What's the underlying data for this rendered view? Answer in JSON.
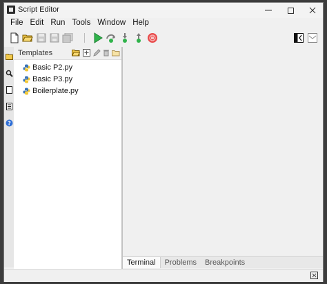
{
  "window": {
    "title": "Script Editor"
  },
  "menubar": [
    "File",
    "Edit",
    "Run",
    "Tools",
    "Window",
    "Help"
  ],
  "toolbar": {
    "buttons": [
      "new-file-icon",
      "open-folder-icon",
      "save-icon",
      "save-as-icon",
      "save-all-icon",
      "run-icon",
      "step-over-icon",
      "step-into-icon",
      "step-out-icon",
      "stop-icon",
      "toggle-panel-icon",
      "maximize-editor-icon"
    ],
    "colors": {
      "run": "#2fb34a",
      "stop": "#e84a4a"
    }
  },
  "sidebar": {
    "icons": [
      "templates-folder-icon",
      "search-icon",
      "page-icon",
      "notes-icon",
      "help-icon"
    ]
  },
  "templates": {
    "title": "Templates",
    "header_icons": [
      "open-template-folder-icon",
      "add-template-icon",
      "edit-template-icon",
      "delete-template-icon",
      "browse-folder-icon"
    ],
    "items": [
      {
        "label": "Basic P2.py"
      },
      {
        "label": "Basic P3.py"
      },
      {
        "label": "Boilerplate.py"
      }
    ]
  },
  "bottom_tabs": [
    {
      "label": "Terminal",
      "active": true
    },
    {
      "label": "Problems",
      "active": false
    },
    {
      "label": "Breakpoints",
      "active": false
    }
  ]
}
